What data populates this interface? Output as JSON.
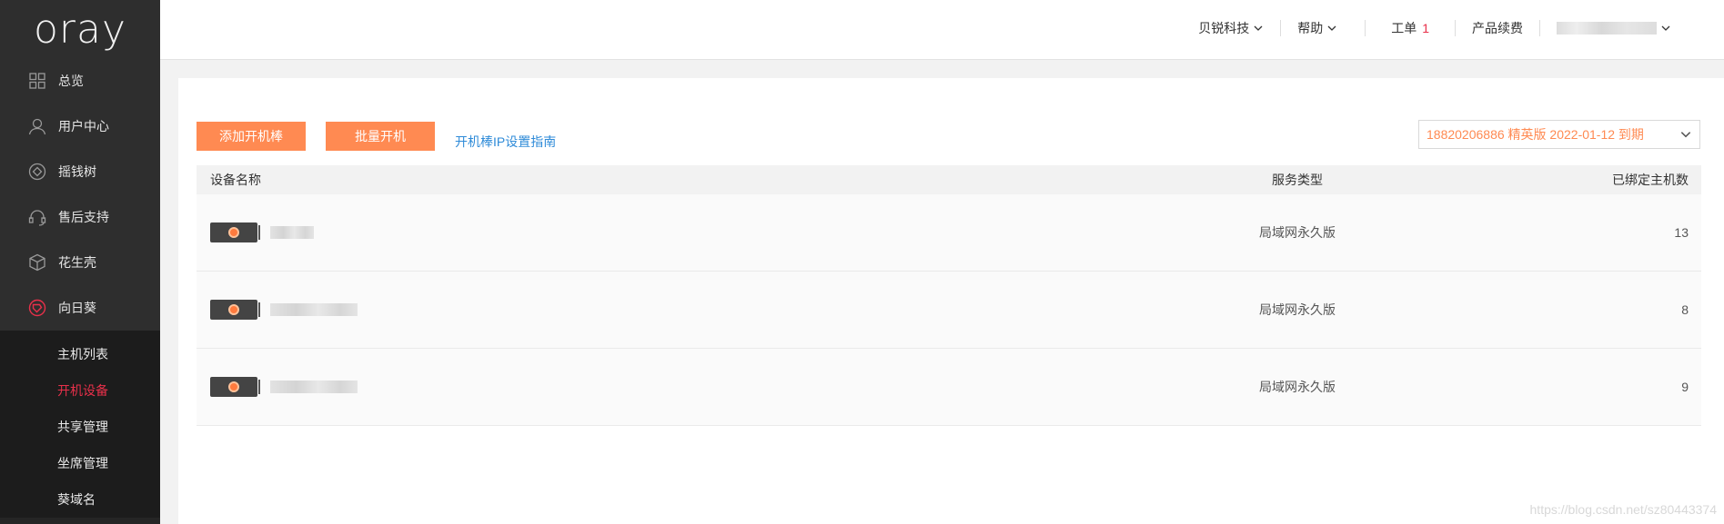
{
  "brand": {
    "logo": "oray"
  },
  "sidebar": {
    "items": [
      {
        "label": "总览",
        "icon": "grid-icon"
      },
      {
        "label": "用户中心",
        "icon": "user-icon"
      },
      {
        "label": "摇钱树",
        "icon": "diamond-icon"
      },
      {
        "label": "售后支持",
        "icon": "headset-icon"
      },
      {
        "label": "花生壳",
        "icon": "cube-icon"
      },
      {
        "label": "向日葵",
        "icon": "sunflower-icon"
      }
    ],
    "sub_items": [
      {
        "label": "主机列表"
      },
      {
        "label": "开机设备",
        "active": true
      },
      {
        "label": "共享管理"
      },
      {
        "label": "坐席管理"
      },
      {
        "label": "葵域名"
      }
    ]
  },
  "topbar": {
    "company": "贝锐科技",
    "help": "帮助",
    "tickets": "工单",
    "tickets_count": "1",
    "renew": "产品续费"
  },
  "toolbar": {
    "add_button": "添加开机棒",
    "batch_button": "批量开机",
    "guide_link": "开机棒IP设置指南"
  },
  "plan_select": {
    "value": "18820206886 精英版 2022-01-12 到期"
  },
  "table": {
    "headers": {
      "name": "设备名称",
      "type": "服务类型",
      "count": "已绑定主机数"
    },
    "rows": [
      {
        "type": "局域网永久版",
        "count": "13"
      },
      {
        "type": "局域网永久版",
        "count": "8"
      },
      {
        "type": "局域网永久版",
        "count": "9"
      }
    ]
  },
  "watermark": "https://blog.csdn.net/sz80443374",
  "colors": {
    "accent": "#ff8a52",
    "active": "#e8304a",
    "link": "#2f8bd8",
    "sidebar": "#2e2e2e"
  }
}
